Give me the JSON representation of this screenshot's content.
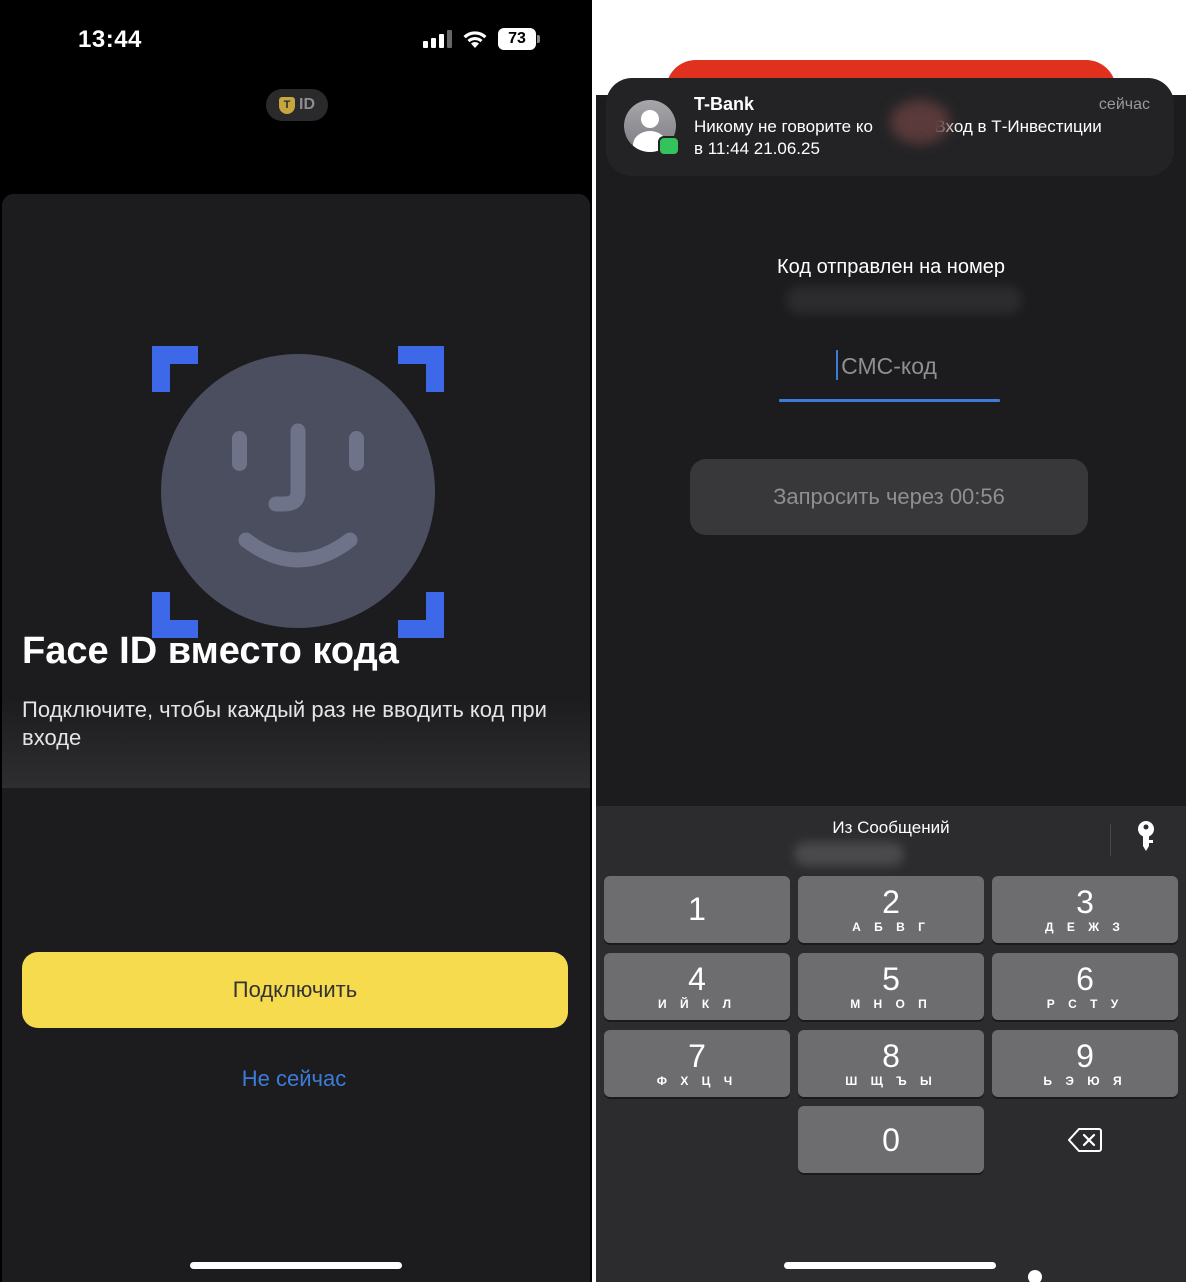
{
  "left_screen": {
    "status_bar": {
      "time": "13:44",
      "battery": "73"
    },
    "badge": {
      "shield_letter": "T",
      "label": "ID"
    },
    "title": "Face ID вместо кода",
    "description": "Подключите, чтобы каждый раз не вводить код при входе",
    "connect_button": "Подключить",
    "not_now_link": "Не сейчас",
    "icons": [
      "signal-icon",
      "wifi-icon",
      "battery-icon",
      "face-id-icon"
    ],
    "colors": {
      "accent_yellow": "#F6DB4E",
      "accent_blue": "#3D7BD9",
      "face_frame_blue": "#3D68E8"
    }
  },
  "right_screen": {
    "notification": {
      "sender": "T-Bank",
      "time": "сейчас",
      "text_part1": "Никому не говорите ко",
      "text_part2": "! Вход в Т-Инвестиции",
      "text_line2": "в 11:44 21.06.25"
    },
    "code_sent_label": "Код отправлен на номер",
    "sms_input": {
      "placeholder": "СМС-код",
      "value": ""
    },
    "resend_button": "Запросить через 00:56",
    "keyboard": {
      "suggestion_label": "Из Сообщений",
      "keys": [
        {
          "digit": "1",
          "letters": ""
        },
        {
          "digit": "2",
          "letters": "А Б В Г"
        },
        {
          "digit": "3",
          "letters": "Д Е Ж З"
        },
        {
          "digit": "4",
          "letters": "И Й К Л"
        },
        {
          "digit": "5",
          "letters": "М Н О П"
        },
        {
          "digit": "6",
          "letters": "Р С Т У"
        },
        {
          "digit": "7",
          "letters": "Ф Х Ц Ч"
        },
        {
          "digit": "8",
          "letters": "Ш Щ Ъ Ы"
        },
        {
          "digit": "9",
          "letters": "Ь Э Ю Я"
        },
        {
          "digit": "0",
          "letters": ""
        }
      ]
    }
  }
}
